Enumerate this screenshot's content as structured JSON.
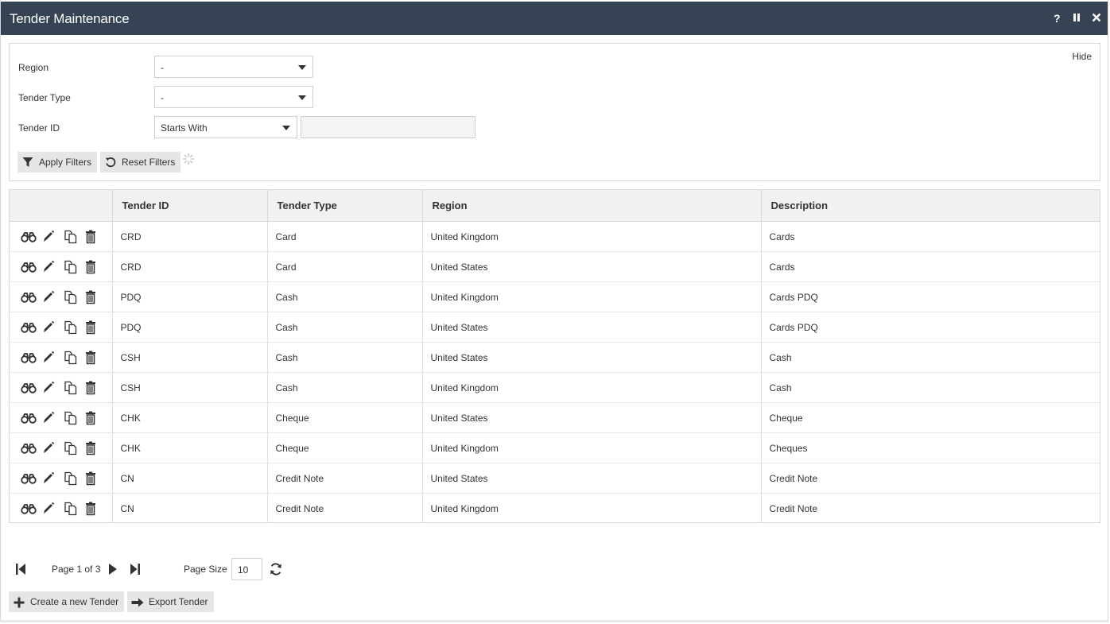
{
  "window": {
    "title": "Tender Maintenance",
    "help_icon": "?",
    "pause_icon": "⏸",
    "close_icon": "✕"
  },
  "filters": {
    "hide_label": "Hide",
    "region": {
      "label": "Region",
      "value": "-"
    },
    "tender_type": {
      "label": "Tender Type",
      "value": "-"
    },
    "tender_id": {
      "label": "Tender ID",
      "operator": "Starts With",
      "value": ""
    },
    "apply_label": "Apply Filters",
    "reset_label": "Reset Filters"
  },
  "grid": {
    "columns": [
      "",
      "Tender ID",
      "Tender Type",
      "Region",
      "Description"
    ],
    "rows": [
      {
        "tender_id": "CRD",
        "tender_type": "Card",
        "region": "United Kingdom",
        "description": "Cards"
      },
      {
        "tender_id": "CRD",
        "tender_type": "Card",
        "region": "United States",
        "description": "Cards"
      },
      {
        "tender_id": "PDQ",
        "tender_type": "Cash",
        "region": "United Kingdom",
        "description": "Cards PDQ"
      },
      {
        "tender_id": "PDQ",
        "tender_type": "Cash",
        "region": "United States",
        "description": "Cards PDQ"
      },
      {
        "tender_id": "CSH",
        "tender_type": "Cash",
        "region": "United States",
        "description": "Cash"
      },
      {
        "tender_id": "CSH",
        "tender_type": "Cash",
        "region": "United Kingdom",
        "description": "Cash"
      },
      {
        "tender_id": "CHK",
        "tender_type": "Cheque",
        "region": "United States",
        "description": "Cheque"
      },
      {
        "tender_id": "CHK",
        "tender_type": "Cheque",
        "region": "United Kingdom",
        "description": "Cheques"
      },
      {
        "tender_id": "CN",
        "tender_type": "Credit Note",
        "region": "United States",
        "description": "Credit Note"
      },
      {
        "tender_id": "CN",
        "tender_type": "Credit Note",
        "region": "United Kingdom",
        "description": "Credit Note"
      }
    ],
    "row_actions": [
      "view-icon",
      "edit-icon",
      "copy-icon",
      "delete-icon"
    ]
  },
  "pager": {
    "page_text": "Page 1 of 3",
    "page_size_label": "Page Size",
    "page_size": "10"
  },
  "actions": {
    "create_label": "Create a new Tender",
    "export_label": "Export Tender"
  },
  "colors": {
    "titlebar": "#354354",
    "button_bg": "#e6e6e6",
    "header_bg": "#f1f1f1"
  }
}
